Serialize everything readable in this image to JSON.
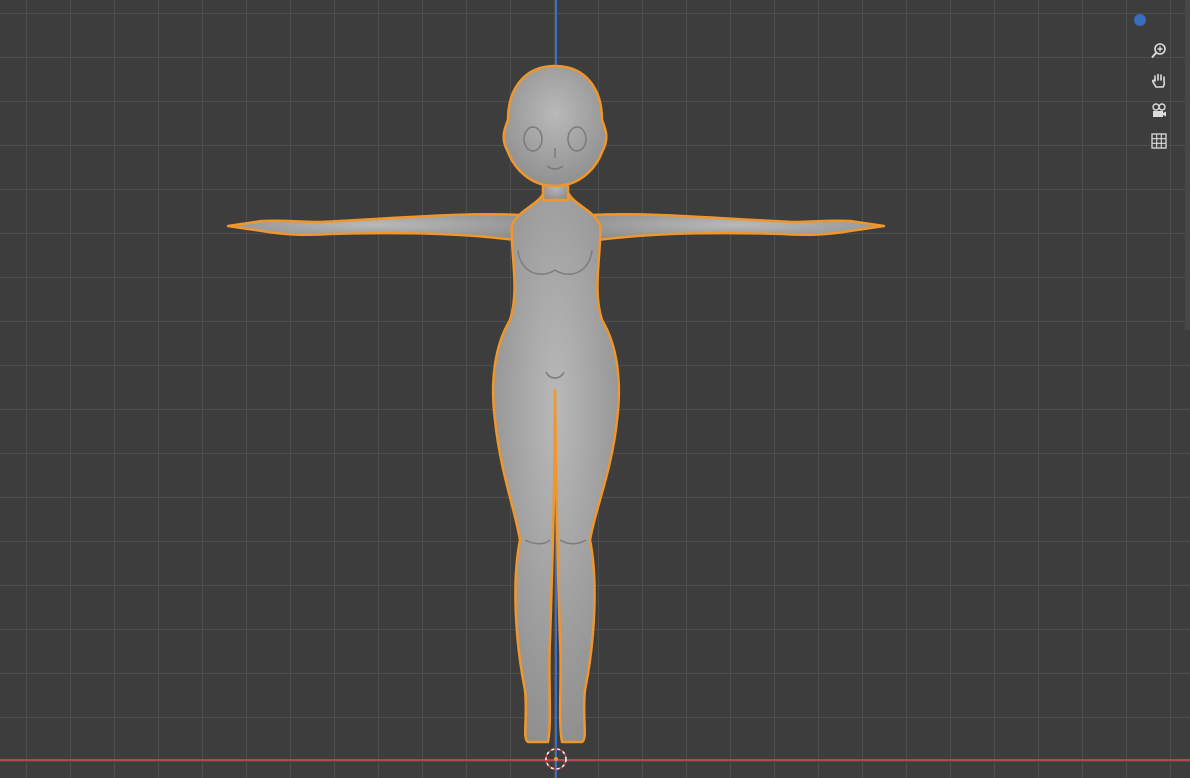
{
  "app": {
    "name": ""
  },
  "viewport": {
    "background_color": "#3d3d3d",
    "grid_color": "#505050",
    "axis_z_color": "#3a6fc4",
    "axis_x_color": "#b34a4a",
    "selection_outline_color": "#f0962a",
    "model_fill_color": "#9a9a9a"
  },
  "navigation_gizmo": {
    "axis_indicator_color": "#3b6dbf",
    "icons": [
      "zoom-icon",
      "hand-pan-icon",
      "camera-view-icon",
      "grid-ortho-icon"
    ]
  }
}
